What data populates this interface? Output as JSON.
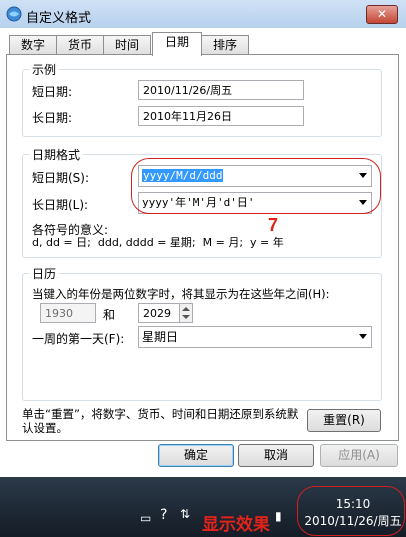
{
  "window": {
    "title": "自定义格式",
    "close_label": "✕"
  },
  "tabs": [
    {
      "label": "数字"
    },
    {
      "label": "货币"
    },
    {
      "label": "时间"
    },
    {
      "label": "日期",
      "active": true
    },
    {
      "label": "排序"
    }
  ],
  "example": {
    "legend": "示例",
    "short_label": "短日期:",
    "short_value": "2010/11/26/周五",
    "long_label": "长日期:",
    "long_value": "2010年11月26日"
  },
  "date_format": {
    "legend": "日期格式",
    "short_label": "短日期(S):",
    "short_value": "yyyy/M/d/ddd",
    "long_label": "长日期(L):",
    "long_value": "yyyy'年'M'月'd'日'",
    "symbols_title": "各符号的意义:",
    "symbols_desc": "d, dd = 日;  ddd, dddd = 星期;  M = 月;  y = 年"
  },
  "annotation_number": "7",
  "calendar": {
    "legend": "日历",
    "two_digit_text": "当键入的年份是两位数字时，将其显示为在这些年之间(H):",
    "year_from": "1930",
    "and_label": "和",
    "year_to": "2029",
    "first_day_label": "一周的第一天(F):",
    "first_day_value": "星期日"
  },
  "reset": {
    "text": "单击“重置”，将数字、货币、时间和日期还原到系统默认设置。",
    "button": "重置(R)"
  },
  "buttons": {
    "ok": "确定",
    "cancel": "取消",
    "apply": "应用(A)"
  },
  "taskbar": {
    "caption": "显示效果",
    "time": "15:10",
    "date": "2010/11/26/周五"
  },
  "colors": {
    "annotation": "#e2231a",
    "selection": "#3399ff"
  }
}
